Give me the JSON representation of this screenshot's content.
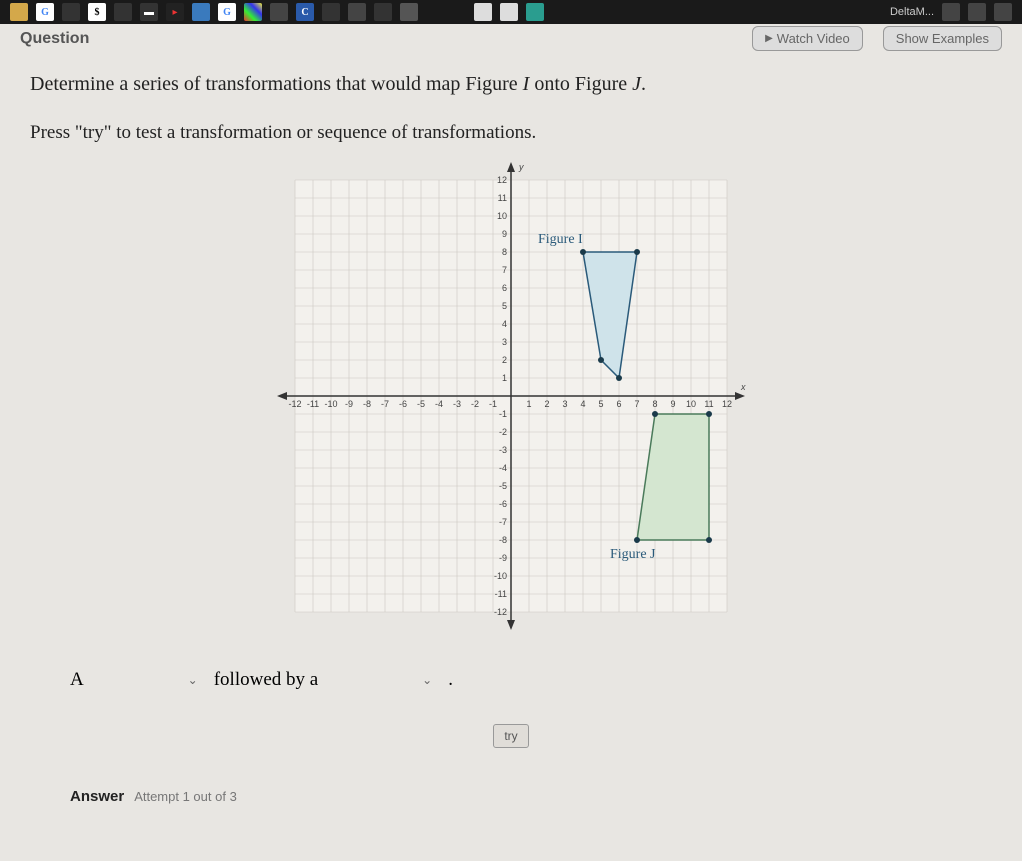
{
  "taskbar": {
    "delta": "DeltaM..."
  },
  "topRow": {
    "question": "Question",
    "watchVideo": "Watch Video",
    "showExamples": "Show Examples"
  },
  "prompt": {
    "pre": "Determine a series of transformations that would map Figure ",
    "figI": "I",
    "mid": " onto Figure ",
    "figJ": "J",
    "post": "."
  },
  "instruction": "Press \"try\" to test a transformation or sequence of transformations.",
  "sentence": {
    "A": "A",
    "followed": "followed by a",
    "period": "."
  },
  "tryLabel": "try",
  "answer": {
    "label": "Answer",
    "attempt": "Attempt 1 out of 3"
  },
  "chart_data": {
    "type": "coordinate-plane",
    "xlabel": "x",
    "ylabel": "y",
    "xlim": [
      -12,
      12
    ],
    "ylim": [
      -12,
      12
    ],
    "x_ticks": [
      -12,
      -11,
      -10,
      -9,
      -8,
      -7,
      -6,
      -5,
      -4,
      -3,
      -2,
      -1,
      1,
      2,
      3,
      4,
      5,
      6,
      7,
      8,
      9,
      10,
      11,
      12
    ],
    "y_ticks": [
      -12,
      -11,
      -10,
      -9,
      -8,
      -7,
      -6,
      -5,
      -4,
      -3,
      -2,
      -1,
      1,
      2,
      3,
      4,
      5,
      6,
      7,
      8,
      9,
      10,
      11,
      12
    ],
    "figures": [
      {
        "name": "Figure I",
        "label_pos": [
          1.5,
          8.5
        ],
        "fill": "#cfe3ea",
        "vertices": [
          [
            4,
            8
          ],
          [
            7,
            8
          ],
          [
            6,
            1
          ],
          [
            5,
            2
          ]
        ]
      },
      {
        "name": "Figure J",
        "label_pos": [
          5.5,
          -9
        ],
        "fill": "#d4e6d0",
        "vertices": [
          [
            8,
            -1
          ],
          [
            11,
            -1
          ],
          [
            11,
            -8
          ],
          [
            7,
            -8
          ]
        ]
      }
    ]
  }
}
